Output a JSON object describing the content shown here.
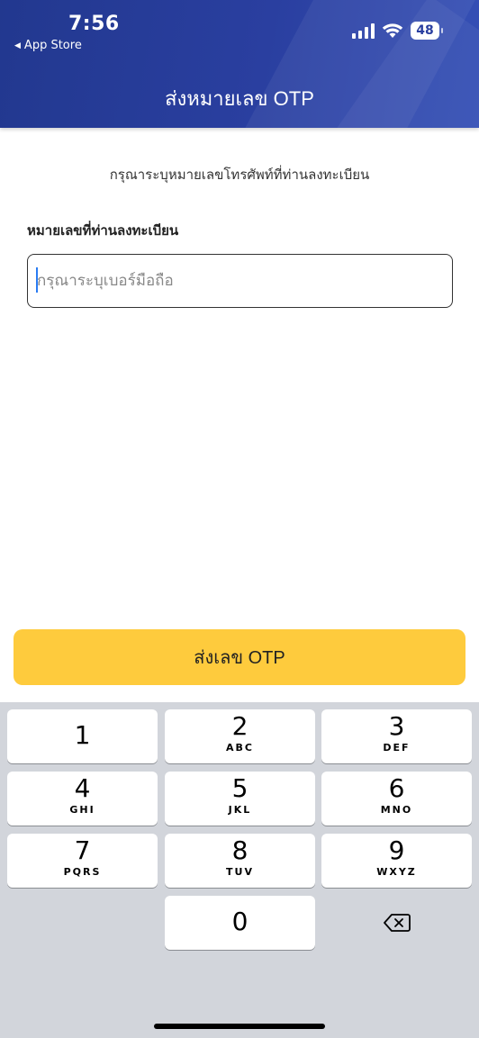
{
  "status_bar": {
    "time": "7:56",
    "back_label": "App Store",
    "battery": "48"
  },
  "header": {
    "title": "ส่งหมายเลข OTP"
  },
  "content": {
    "subtitle": "กรุณาระบุหมายเลขโทรศัพท์ที่ท่านลงทะเบียน",
    "field_label": "หมายเลขที่ท่านลงทะเบียน",
    "phone_placeholder": "กรุณาระบุเบอร์มือถือ",
    "phone_value": ""
  },
  "send_button": {
    "label": "ส่งเลข OTP",
    "color": "#fecb3d"
  },
  "keypad": {
    "keys": [
      {
        "num": "1",
        "letters": ""
      },
      {
        "num": "2",
        "letters": "ABC"
      },
      {
        "num": "3",
        "letters": "DEF"
      },
      {
        "num": "4",
        "letters": "GHI"
      },
      {
        "num": "5",
        "letters": "JKL"
      },
      {
        "num": "6",
        "letters": "MNO"
      },
      {
        "num": "7",
        "letters": "PQRS"
      },
      {
        "num": "8",
        "letters": "TUV"
      },
      {
        "num": "9",
        "letters": "WXYZ"
      },
      {
        "num": "0",
        "letters": ""
      }
    ],
    "backspace_icon": "backspace-icon"
  },
  "colors": {
    "header": "#2a3fa0",
    "accent": "#fecb3d",
    "keyboard_bg": "#d2d5db"
  }
}
